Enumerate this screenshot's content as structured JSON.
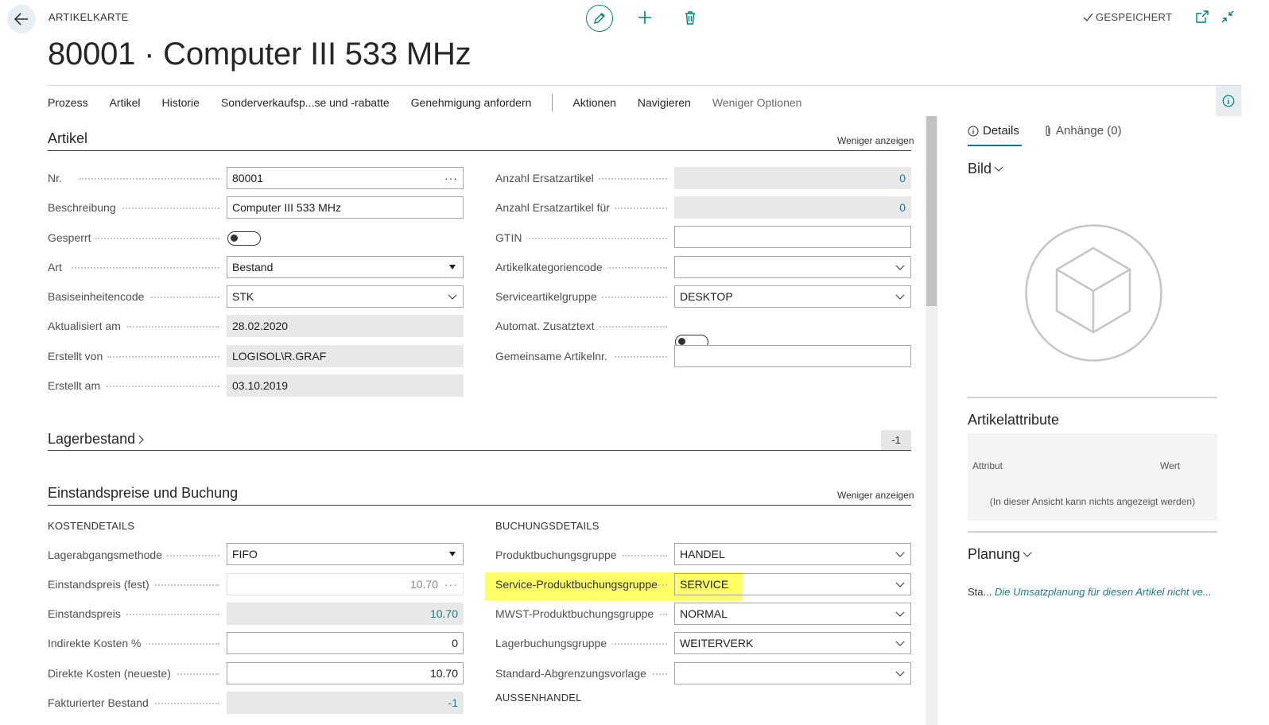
{
  "header": {
    "kicker": "ARTIKELKARTE",
    "title": "80001 · Computer III 533 MHz",
    "saved_label": "GESPEICHERT"
  },
  "actionbar": {
    "items": [
      "Prozess",
      "Artikel",
      "Historie",
      "Sonderverkaufsp...se und -rabatte",
      "Genehmigung anfordern"
    ],
    "items2": [
      "Aktionen",
      "Navigieren"
    ],
    "less": "Weniger Optionen"
  },
  "artikel": {
    "title": "Artikel",
    "show_less": "Weniger anzeigen",
    "left": [
      {
        "label": "Nr.",
        "value": "80001"
      },
      {
        "label": "Beschreibung",
        "value": "Computer III 533 MHz"
      },
      {
        "label": "Gesperrt",
        "value": ""
      },
      {
        "label": "Art",
        "value": "Bestand"
      },
      {
        "label": "Basiseinheitencode",
        "value": "STK"
      },
      {
        "label": "Aktualisiert am",
        "value": "28.02.2020"
      },
      {
        "label": "Erstellt von",
        "value": "LOGISOL\\R.GRAF"
      },
      {
        "label": "Erstellt am",
        "value": "03.10.2019"
      }
    ],
    "right": [
      {
        "label": "Anzahl Ersatzartikel",
        "value": "0"
      },
      {
        "label": "Anzahl Ersatzartikel für",
        "value": "0"
      },
      {
        "label": "GTIN",
        "value": ""
      },
      {
        "label": "Artikelkategoriencode",
        "value": ""
      },
      {
        "label": "Serviceartikelgruppe",
        "value": "DESKTOP"
      },
      {
        "label": "Automat. Zusatztext",
        "value": ""
      },
      {
        "label": "Gemeinsame Artikelnr.",
        "value": ""
      }
    ]
  },
  "lager": {
    "title": "Lagerbestand",
    "value": "-1"
  },
  "einstand": {
    "title": "Einstandspreise und Buchung",
    "show_less": "Weniger anzeigen",
    "kosten_heading": "KOSTENDETAILS",
    "buchung_heading": "BUCHUNGSDETAILS",
    "aussen_heading": "AUSSENHANDEL",
    "left": [
      {
        "label": "Lagerabgangsmethode",
        "value": "FIFO"
      },
      {
        "label": "Einstandspreis (fest)",
        "value": "10.70"
      },
      {
        "label": "Einstandspreis",
        "value": "10.70"
      },
      {
        "label": "Indirekte Kosten %",
        "value": "0"
      },
      {
        "label": "Direkte Kosten (neueste)",
        "value": "10.70"
      },
      {
        "label": "Fakturierter Bestand",
        "value": "-1"
      }
    ],
    "right": [
      {
        "label": "Produktbuchungsgruppe",
        "value": "HANDEL"
      },
      {
        "label": "Service-Produktbuchungsgruppe",
        "value": "SERVICE"
      },
      {
        "label": "MWST-Produktbuchungsgruppe",
        "value": "NORMAL"
      },
      {
        "label": "Lagerbuchungsgruppe",
        "value": "WEITERVERK"
      },
      {
        "label": "Standard-Abgrenzungsvorlage",
        "value": ""
      }
    ]
  },
  "factbox": {
    "tab_details": "Details",
    "tab_attachments": "Anhänge (0)",
    "bild_title": "Bild",
    "attr_title": "Artikelattribute",
    "attr_col1": "Attribut",
    "attr_col2": "Wert",
    "attr_empty": "(In dieser Ansicht kann nichts angezeigt werden)",
    "planung_title": "Planung",
    "forecast_prefix": "Sta...",
    "forecast_text": "Die Umsatzplanung für diesen Artikel nicht ve..."
  },
  "colors": {
    "accent": "#00807f",
    "highlight": "#ffff66",
    "link_teal": "#1e7a8a"
  }
}
